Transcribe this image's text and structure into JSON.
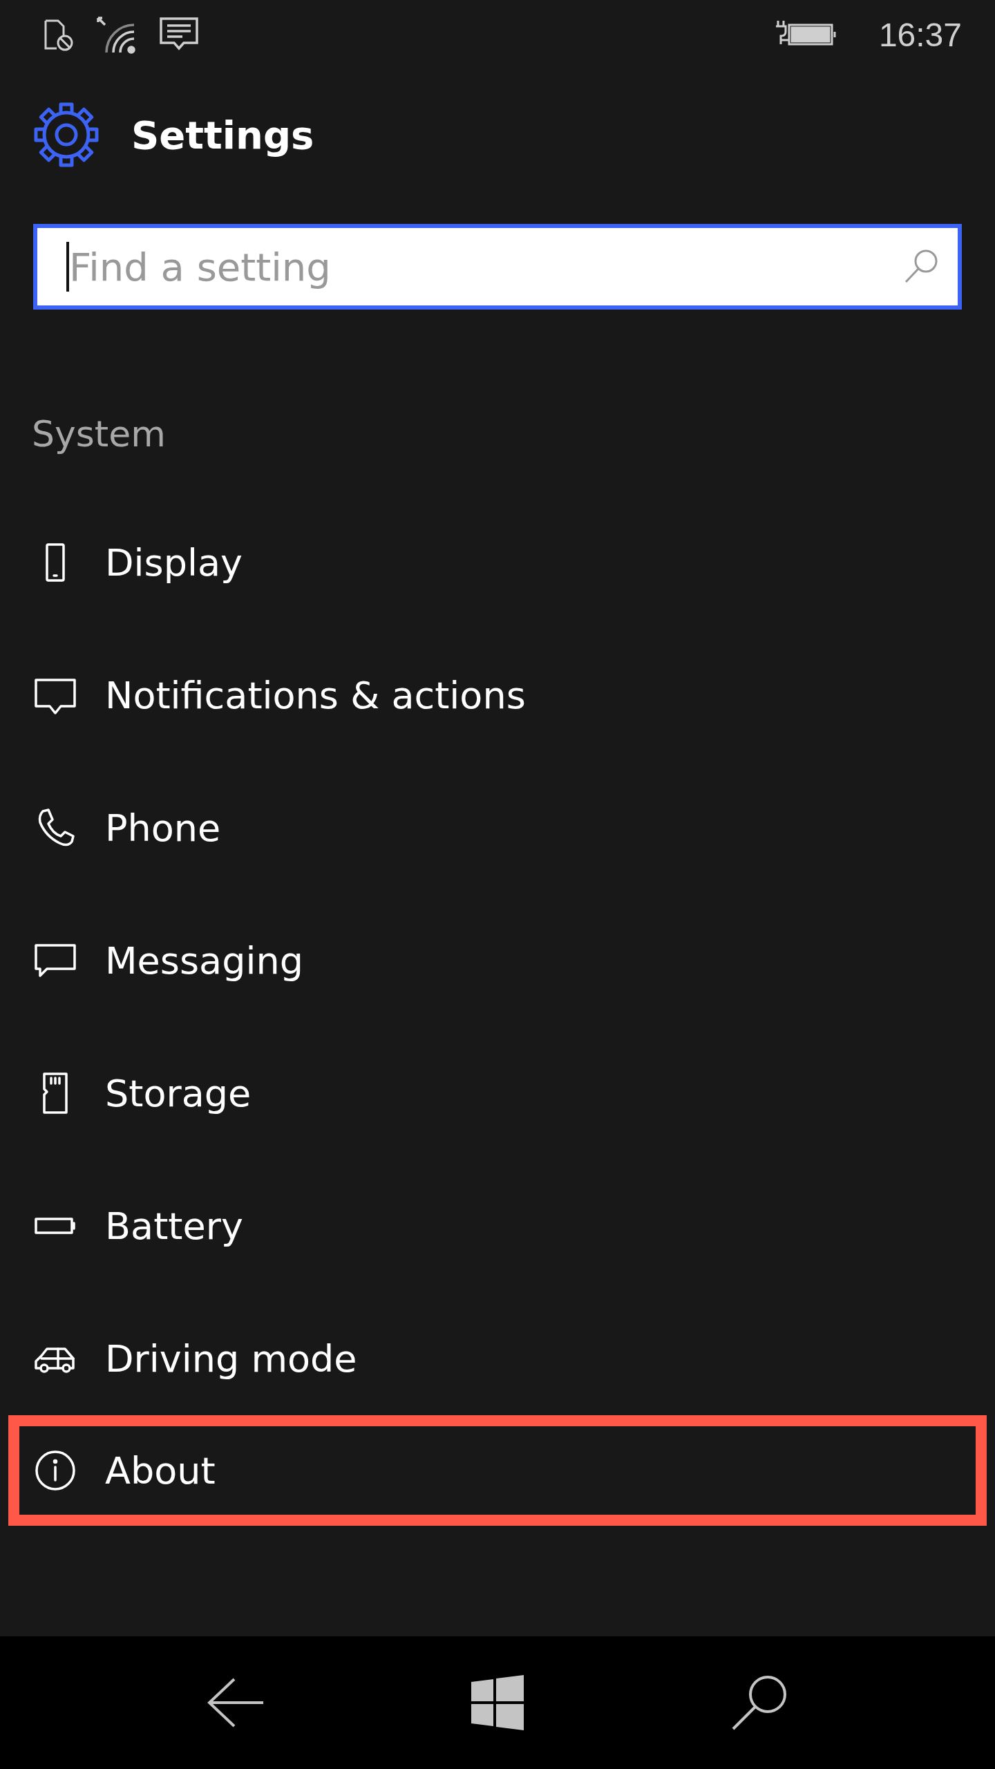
{
  "status_bar": {
    "time": "16:37"
  },
  "header": {
    "title": "Settings"
  },
  "search": {
    "placeholder": "Find a setting"
  },
  "section": {
    "title": "System"
  },
  "items": [
    {
      "label": "Display",
      "highlighted": false
    },
    {
      "label": "Notifications & actions",
      "highlighted": false
    },
    {
      "label": "Phone",
      "highlighted": false
    },
    {
      "label": "Messaging",
      "highlighted": false
    },
    {
      "label": "Storage",
      "highlighted": false
    },
    {
      "label": "Battery",
      "highlighted": false
    },
    {
      "label": "Driving mode",
      "highlighted": false
    },
    {
      "label": "About",
      "highlighted": true
    }
  ]
}
